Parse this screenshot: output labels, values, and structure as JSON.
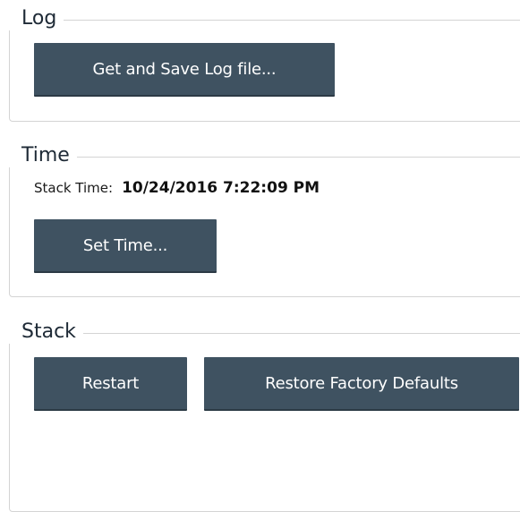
{
  "log": {
    "title": "Log",
    "get_and_save_label": "Get and Save Log file..."
  },
  "time": {
    "title": "Time",
    "stack_time_label": "Stack Time:",
    "stack_time_value": "10/24/2016 7:22:09 PM",
    "set_time_label": "Set Time..."
  },
  "stack": {
    "title": "Stack",
    "restart_label": "Restart",
    "restore_label": "Restore Factory Defaults"
  },
  "colors": {
    "button_bg": "#3f5261",
    "group_border": "#d4d4d4",
    "title_text": "#1e2a36"
  }
}
